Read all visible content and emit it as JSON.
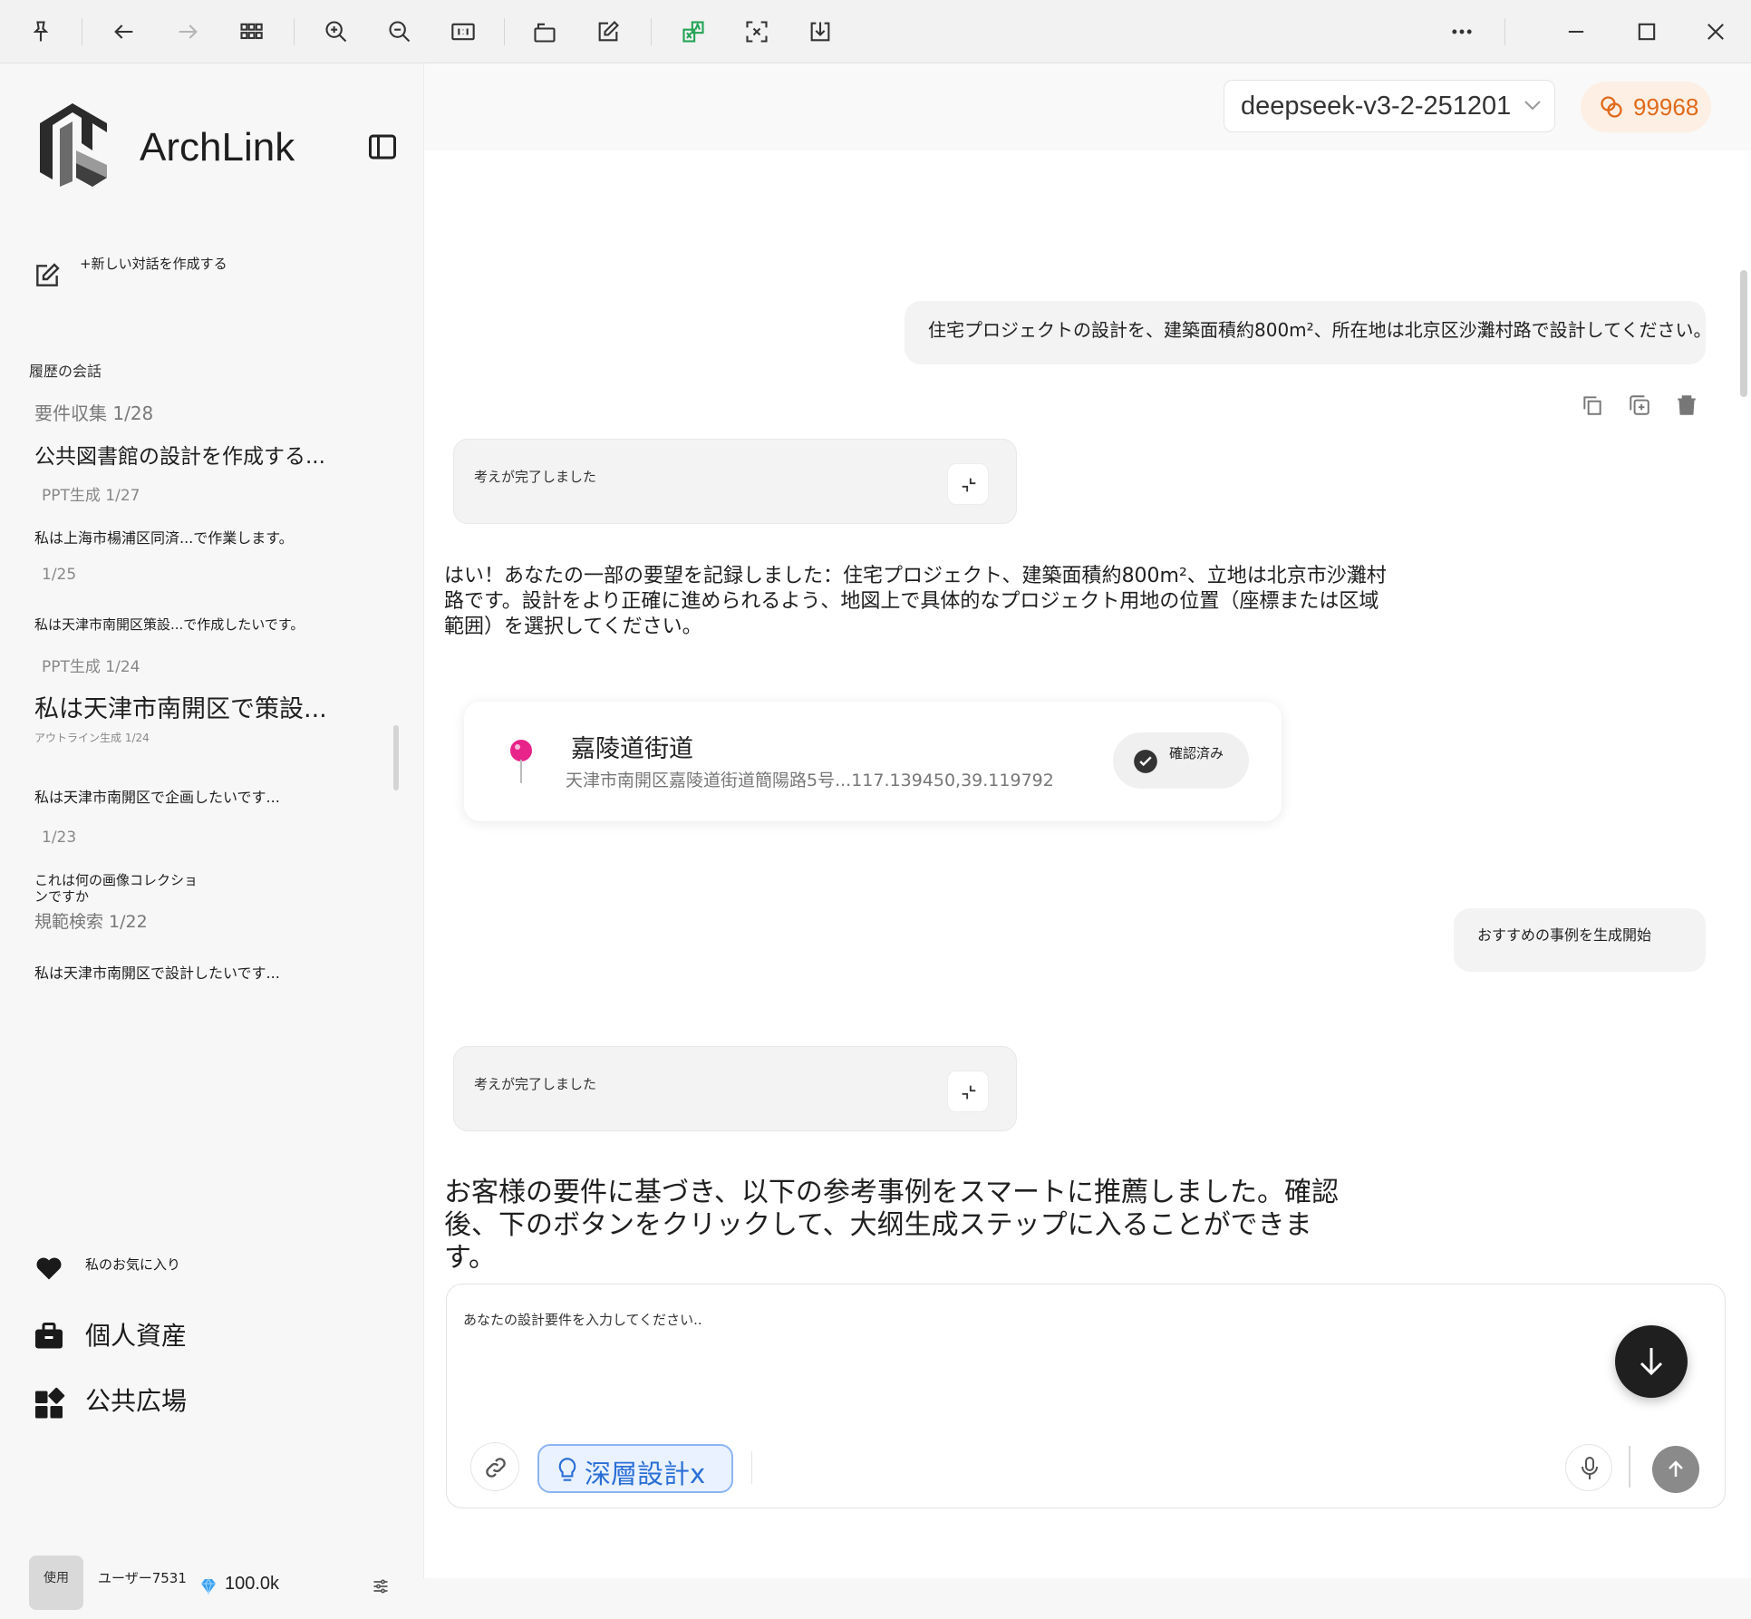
{
  "sidebar": {
    "app_name": "ArchLink",
    "new_chat_label": "+新しい対話を作成する",
    "history_label": "履歴の会話",
    "history": [
      {
        "title": "",
        "meta": "要件収集 1/28"
      },
      {
        "title": "公共図書館の設計を作成する...",
        "meta": "PPT生成   1/27"
      },
      {
        "title": "私は上海市楊浦区同済...で作業します。",
        "meta": "1/25"
      },
      {
        "title": "私は天津市南開区策設...で作成したいです。",
        "meta": "PPT生成   1/24"
      },
      {
        "title": "私は天津市南開区で策設...",
        "meta": "アウトライン生成 1/24"
      },
      {
        "title": "私は天津市南開区で企画したいです...",
        "meta": "1/23"
      },
      {
        "title": "これは何の画像コレクションですか",
        "meta": "規範検索 1/22"
      },
      {
        "title": "私は天津市南開区で設計したいです...",
        "meta": ""
      }
    ],
    "favorites_label": "私のお気に入り",
    "assets_label": "個人資産",
    "plaza_label": "公共広場",
    "user": {
      "avatar_text": "使用",
      "name": "ユーザー7531",
      "tokens": "100.0k"
    }
  },
  "header": {
    "model": "deepseek-v3-2-251201",
    "credits": "99968"
  },
  "messages": {
    "user_1": "住宅プロジェクトの設計を、建築面積約800m²、所在地は北京区沙灘村路で設計してください。",
    "think_1": "考えが完了しました",
    "ai_1": "はい！あなたの一部の要望を記録しました：住宅プロジェクト、建築面積約800m²、立地は北京市沙灘村路です。設計をより正確に進められるよう、地図上で具体的なプロジェクト用地の位置（座標または区域範囲）を選択してください。",
    "location": {
      "name": "嘉陵道街道",
      "address": "天津市南開区嘉陵道街道簡陽路5号...117.139450,39.119792",
      "confirm_label": "確認済み"
    },
    "user_2": "おすすめの事例を生成開始",
    "think_2": "考えが完了しました",
    "ai_2": "お客様の要件に基づき、以下の参考事例をスマートに推薦しました。確認後、下のボタンをクリックして、大纲生成ステップに入ることができます。"
  },
  "input": {
    "placeholder": "あなたの設計要件を入力してください..",
    "deep_design_label": "深層設計x"
  },
  "colors": {
    "accent_orange": "#e06a1b",
    "accent_blue": "#2a6fd6",
    "pin": "#e8238a"
  }
}
